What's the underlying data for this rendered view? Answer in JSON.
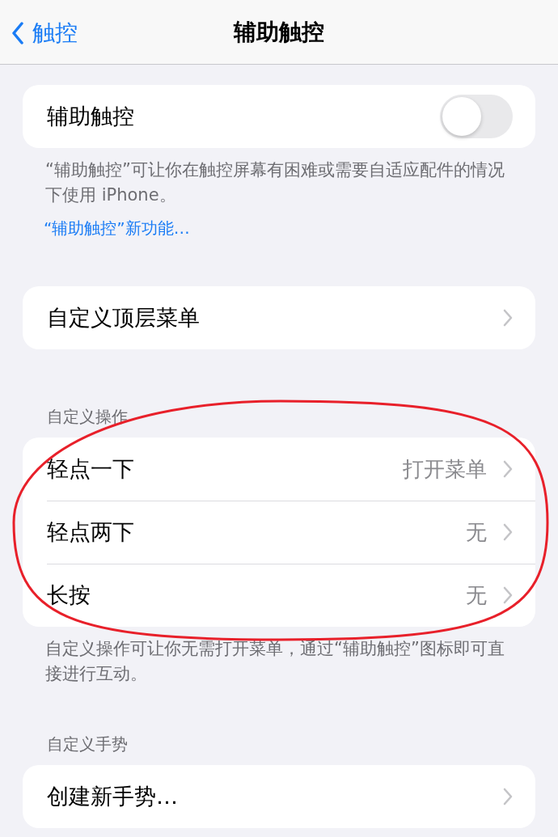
{
  "nav": {
    "back_label": "触控",
    "title": "辅助触控"
  },
  "main_toggle": {
    "label": "辅助触控",
    "on": false
  },
  "main_footer": {
    "text": "“辅助触控”可让你在触控屏幕有困难或需要自适应配件的情况下使用 iPhone。",
    "link": "“辅助触控”新功能…"
  },
  "top_menu": {
    "label": "自定义顶层菜单"
  },
  "custom_actions": {
    "header": "自定义操作",
    "rows": [
      {
        "label": "轻点一下",
        "value": "打开菜单"
      },
      {
        "label": "轻点两下",
        "value": "无"
      },
      {
        "label": "长按",
        "value": "无"
      }
    ],
    "footer": "自定义操作可让你无需打开菜单，通过“辅助触控”图标即可直接进行互动。",
    "annotation": {
      "kind": "ellipse",
      "color": "#e8202a"
    }
  },
  "custom_gestures": {
    "header": "自定义手势",
    "rows": [
      {
        "label": "创建新手势…"
      }
    ]
  }
}
